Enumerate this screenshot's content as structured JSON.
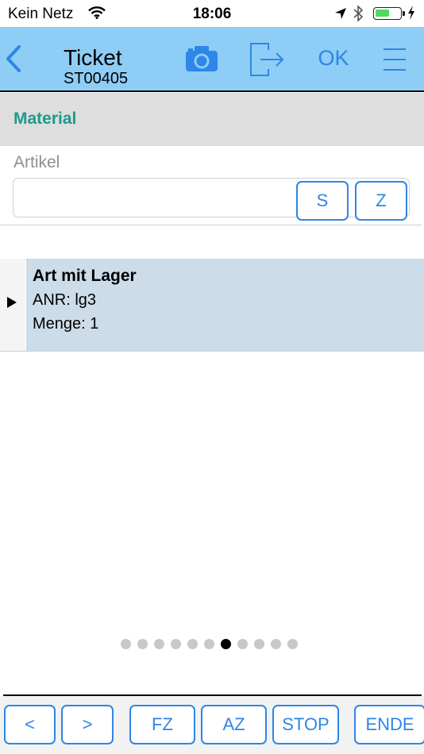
{
  "status_bar": {
    "carrier": "Kein Netz",
    "time": "18:06",
    "battery_level": 0.6
  },
  "nav": {
    "title": "Ticket",
    "subtitle": "ST00405",
    "ok_label": "OK"
  },
  "section": {
    "title": "Material"
  },
  "artikel": {
    "label": "Artikel",
    "value": "",
    "s_label": "S",
    "z_label": "Z"
  },
  "list": {
    "items": [
      {
        "title": "Art mit Lager",
        "anr": "ANR: lg3",
        "menge": "Menge: 1"
      }
    ]
  },
  "pager": {
    "count": 11,
    "active": 6
  },
  "bottom": {
    "prev_label": "<",
    "next_label": ">",
    "fz_label": "FZ",
    "az_label": "AZ",
    "stop_label": "STOP",
    "ende_label": "ENDE"
  },
  "colors": {
    "nav_bg": "#8ecdf5",
    "accent_blue": "#2e86e8",
    "section_title": "#1d9a8a",
    "selected_row": "#ccdce9"
  }
}
